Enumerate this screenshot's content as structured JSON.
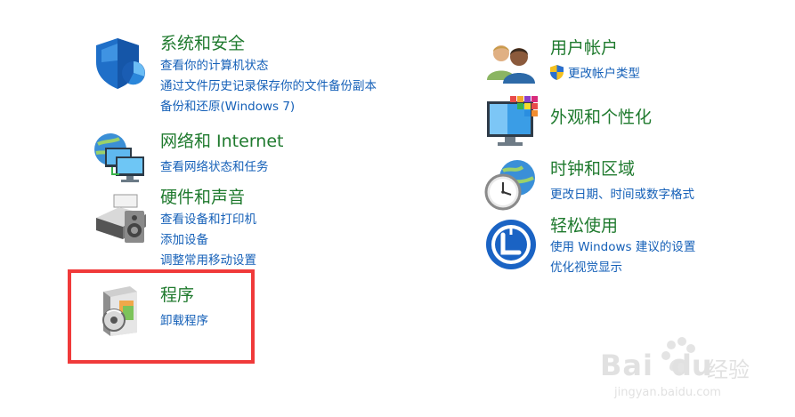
{
  "categories": {
    "system_security": {
      "title": "系统和安全",
      "links": [
        "查看你的计算机状态",
        "通过文件历史记录保存你的文件备份副本",
        "备份和还原(Windows 7)"
      ],
      "icon": "shield-icon"
    },
    "network": {
      "title": "网络和 Internet",
      "links": [
        "查看网络状态和任务"
      ],
      "icon": "network-icon"
    },
    "hardware_sound": {
      "title": "硬件和声音",
      "links": [
        "查看设备和打印机",
        "添加设备",
        "调整常用移动设置"
      ],
      "icon": "printer-speaker-icon"
    },
    "programs": {
      "title": "程序",
      "links": [
        "卸载程序"
      ],
      "icon": "programs-disc-icon"
    },
    "user_accounts": {
      "title": "用户帐户",
      "links": [
        "更改帐户类型"
      ],
      "icon": "users-icon"
    },
    "appearance": {
      "title": "外观和个性化",
      "links": [],
      "icon": "monitor-palette-icon"
    },
    "clock_region": {
      "title": "时钟和区域",
      "links": [
        "更改日期、时间或数字格式"
      ],
      "icon": "clock-globe-icon"
    },
    "ease_access": {
      "title": "轻松使用",
      "links": [
        "使用 Windows 建议的设置",
        "优化视觉显示"
      ],
      "icon": "ease-of-access-icon"
    }
  },
  "watermark": {
    "brand": "Bai",
    "brand2": "du",
    "cn": "经验",
    "url": "jingyan.baidu.com"
  },
  "colors": {
    "title_green": "#1f7a2e",
    "link_blue": "#1560b8",
    "highlight_red": "#f03a3a"
  }
}
